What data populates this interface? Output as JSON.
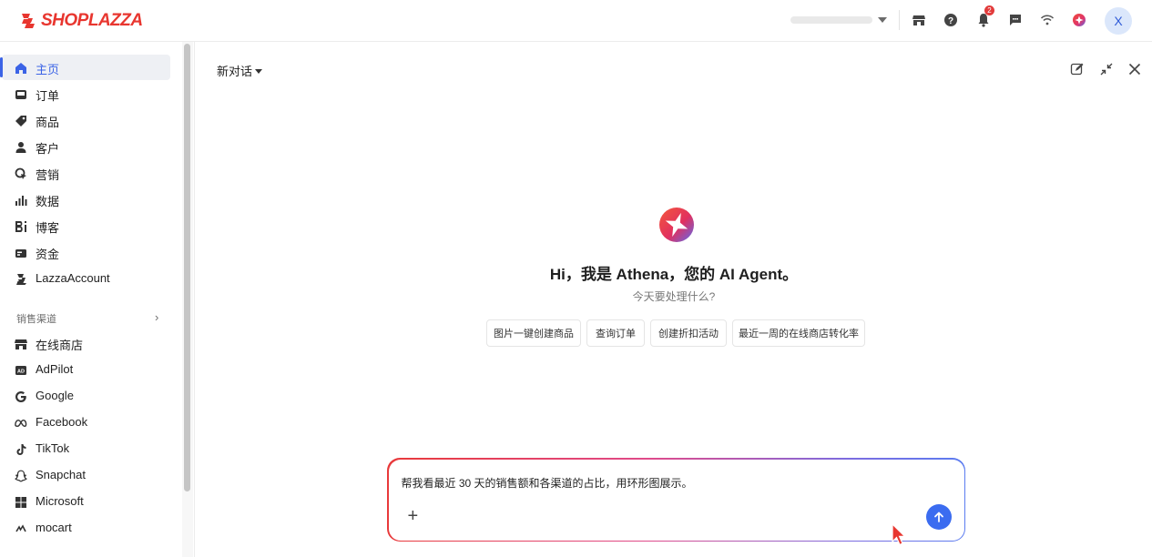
{
  "topbar": {
    "brand": "SHOPLAZZA",
    "store_selector_value": "",
    "notification_count": "2",
    "avatar_initial": "X",
    "icons": [
      "store-icon",
      "help-icon",
      "bell-icon",
      "message-icon",
      "wifi-icon",
      "athena-icon"
    ]
  },
  "sidebar": {
    "items": [
      {
        "label": "主页",
        "icon": "home-icon",
        "active": true
      },
      {
        "label": "订单",
        "icon": "inbox-icon"
      },
      {
        "label": "商品",
        "icon": "tag-icon"
      },
      {
        "label": "客户",
        "icon": "person-icon"
      },
      {
        "label": "营销",
        "icon": "marketing-icon"
      },
      {
        "label": "数据",
        "icon": "bar-chart-icon"
      },
      {
        "label": "博客",
        "icon": "blog-icon"
      },
      {
        "label": "资金",
        "icon": "wallet-icon"
      },
      {
        "label": "LazzaAccount",
        "icon": "lazza-icon"
      }
    ],
    "channels_title": "销售渠道",
    "channels": [
      {
        "label": "在线商店",
        "icon": "store-icon"
      },
      {
        "label": "AdPilot",
        "icon": "ad-icon"
      },
      {
        "label": "Google",
        "icon": "google-icon"
      },
      {
        "label": "Facebook",
        "icon": "meta-icon"
      },
      {
        "label": "TikTok",
        "icon": "tiktok-icon"
      },
      {
        "label": "Snapchat",
        "icon": "snapchat-icon"
      },
      {
        "label": "Microsoft",
        "icon": "microsoft-icon"
      },
      {
        "label": "mocart",
        "icon": "mocart-icon"
      }
    ]
  },
  "main": {
    "conversation_title": "新对话",
    "greeting": "Hi，我是 Athena，您的 AI Agent。",
    "subgreeting": "今天要处理什么?",
    "chips": [
      "图片一键创建商品",
      "查询订单",
      "创建折扣活动",
      "最近一周的在线商店转化率"
    ],
    "composer_text": "帮我看最近 30 天的销售额和各渠道的占比，用环形图展示。",
    "composer_plus": "+"
  },
  "colors": {
    "brand_red": "#e8362f",
    "accent_blue": "#3b63e6",
    "send_blue": "#3b6cf0",
    "badge_red": "#e23b3b"
  }
}
